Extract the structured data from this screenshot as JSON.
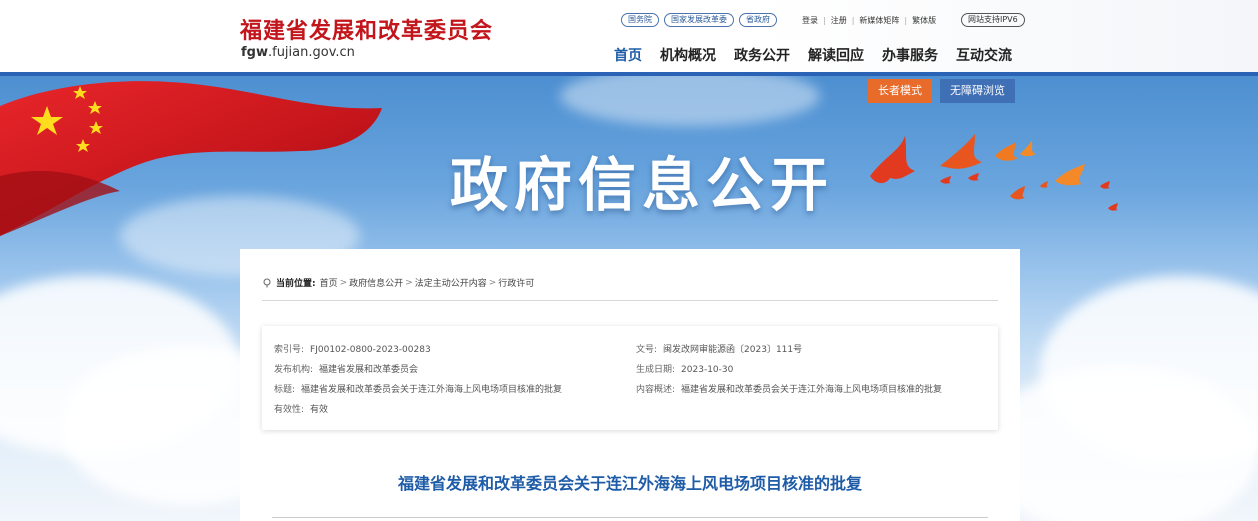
{
  "header": {
    "site_title": "福建省发展和改革委员会",
    "domain_bold": "fgw",
    "domain_rest": ".fujian.gov.cn",
    "top_links": [
      "国务院",
      "国家发展改革委",
      "省政府"
    ],
    "util_links": [
      "登录",
      "注册",
      "新媒体矩阵",
      "繁体版"
    ],
    "ipv6_label": "网站支持IPV6",
    "nav": [
      "首页",
      "机构概况",
      "政务公开",
      "解读回应",
      "办事服务",
      "互动交流"
    ]
  },
  "banner": {
    "title": "政府信息公开",
    "elder_mode": "长者模式",
    "accessible": "无障碍浏览"
  },
  "breadcrumb": {
    "label": "当前位置:",
    "items": [
      "首页",
      "政府信息公开",
      "法定主动公开内容",
      "行政许可"
    ]
  },
  "meta": {
    "index_no_label": "索引号:",
    "index_no": "FJ00102-0800-2023-00283",
    "doc_no_label": "文号:",
    "doc_no": "闽发改网审能源函〔2023〕111号",
    "publisher_label": "发布机构:",
    "publisher": "福建省发展和改革委员会",
    "date_label": "生成日期:",
    "date": "2023-10-30",
    "title_label": "标题:",
    "title": "福建省发展和改革委员会关于连江外海海上风电场项目核准的批复",
    "summary_label": "内容概述:",
    "summary": "福建省发展和改革委员会关于连江外海海上风电场项目核准的批复",
    "validity_label": "有效性:",
    "validity": "有效"
  },
  "article": {
    "title": "福建省发展和改革委员会关于连江外海海上风电场项目核准的批复"
  },
  "colors": {
    "brand_red": "#c3161c",
    "nav_blue": "#1f5ca8",
    "elder_orange": "#e96b2a",
    "access_blue": "#3f6fb4"
  }
}
